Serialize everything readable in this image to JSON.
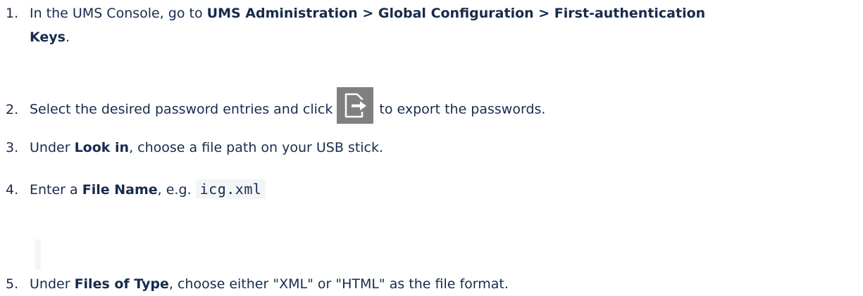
{
  "steps": [
    {
      "number": "1.",
      "intro": "In the UMS Console, go to",
      "path": "UMS Administration > Global Configuration > First-authentication",
      "path_cont": "Keys",
      "end": "."
    },
    {
      "number": "2.",
      "before": "Select the desired password entries and click",
      "icon": "export-icon",
      "after": "to export the passwords."
    },
    {
      "number": "3.",
      "before": "Under",
      "bold": "Look in",
      "after": ", choose a file path on your USB stick."
    },
    {
      "number": "4.",
      "before": "Enter a",
      "bold": "File Name",
      "middle": ", e.g.",
      "code": "icg.xml"
    },
    {
      "number": "5.",
      "before": "Under",
      "bold": "Files of Type",
      "after": ", choose either \"XML\" or \"HTML\" as the file format."
    }
  ]
}
